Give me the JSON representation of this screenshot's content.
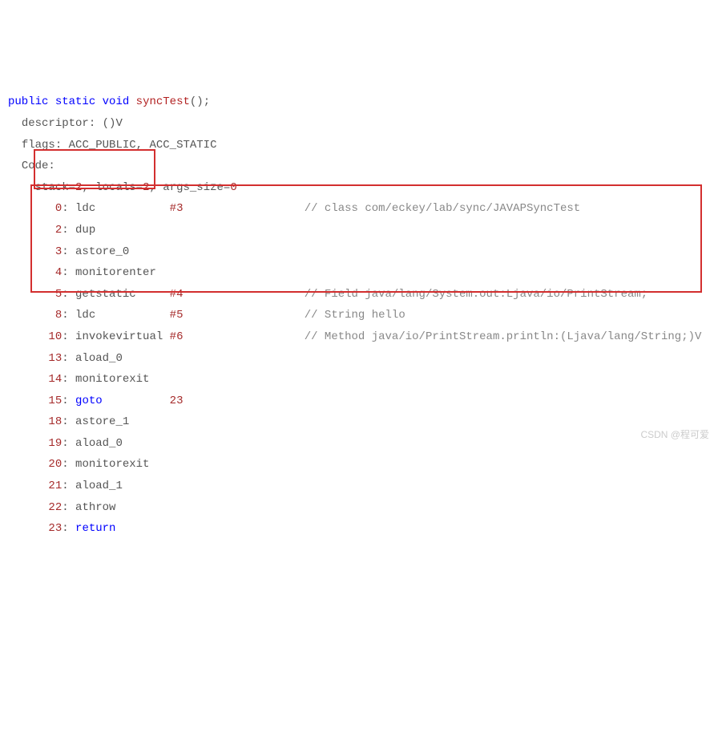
{
  "signature": {
    "kw_public": "public",
    "kw_static": "static",
    "kw_void": "void",
    "method": "syncTest",
    "parens": "();"
  },
  "descriptor_label": "descriptor:",
  "descriptor_value": "()V",
  "flags_label": "flags:",
  "flags_value": "ACC_PUBLIC, ACC_STATIC",
  "code_label": "Code:",
  "stack_line": {
    "stack_lhs": "stack",
    "stack_eq": "=",
    "stack_val": "2",
    "sep1": ", ",
    "locals_lhs": "locals",
    "locals_eq": "=",
    "locals_val": "2",
    "sep2": ", ",
    "args_lhs": "args_size",
    "args_eq": "=",
    "args_val": "0"
  },
  "instr": {
    "l0_idx": "0",
    "l0_op": "ldc",
    "l0_arg": "#3",
    "l0_c": "// class com/eckey/lab/sync/JAVAPSyncTest",
    "l2_idx": "2",
    "l2_op": "dup",
    "l3_idx": "3",
    "l3_op": "astore_0",
    "l4_idx": "4",
    "l4_op": "monitorenter",
    "l5_idx": "5",
    "l5_op": "getstatic",
    "l5_arg": "#4",
    "l5_c": "// Field java/lang/System.out:Ljava/io/PrintStream;",
    "l8_idx": "8",
    "l8_op": "ldc",
    "l8_arg": "#5",
    "l8_c": "// String hello",
    "l10_idx": "10",
    "l10_op": "invokevirtual",
    "l10_arg": "#6",
    "l10_c": "// Method java/io/PrintStream.println:(Ljava/lang/String;)V",
    "l13_idx": "13",
    "l13_op": "aload_0",
    "l14_idx": "14",
    "l14_op": "monitorexit",
    "l15_idx": "15",
    "l15_op": "goto",
    "l15_arg": "23",
    "l18_idx": "18",
    "l18_op": "astore_1",
    "l19_idx": "19",
    "l19_op": "aload_0",
    "l20_idx": "20",
    "l20_op": "monitorexit",
    "l21_idx": "21",
    "l21_op": "aload_1",
    "l22_idx": "22",
    "l22_op": "athrow",
    "l23_idx": "23",
    "l23_op": "return"
  },
  "watermark": "CSDN @程可爱"
}
